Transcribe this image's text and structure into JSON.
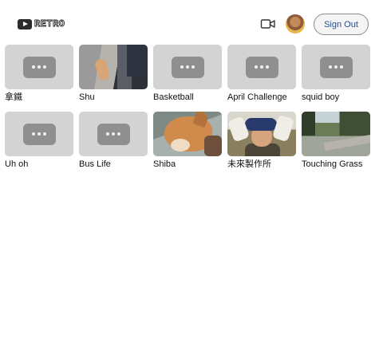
{
  "header": {
    "logo_text": "RETRO",
    "logo_icon": "play-icon",
    "camera_icon": "video-camera-icon",
    "signout_label": "Sign Out"
  },
  "videos": [
    {
      "title": "拿鐵",
      "thumbnail": "placeholder"
    },
    {
      "title": "Shu",
      "thumbnail": "image"
    },
    {
      "title": "Basketball",
      "thumbnail": "placeholder"
    },
    {
      "title": "April Challenge",
      "thumbnail": "placeholder"
    },
    {
      "title": "squid boy",
      "thumbnail": "placeholder"
    },
    {
      "title": "Uh oh",
      "thumbnail": "placeholder"
    },
    {
      "title": "Bus Life",
      "thumbnail": "placeholder"
    },
    {
      "title": "Shiba",
      "thumbnail": "image"
    },
    {
      "title": "未來製作所",
      "thumbnail": "image"
    },
    {
      "title": "Touching Grass",
      "thumbnail": "image"
    }
  ],
  "colors": {
    "placeholder_bg": "#d3d3d3",
    "placeholder_button": "#8f8f8f",
    "signout_text": "#2b4f8e"
  }
}
